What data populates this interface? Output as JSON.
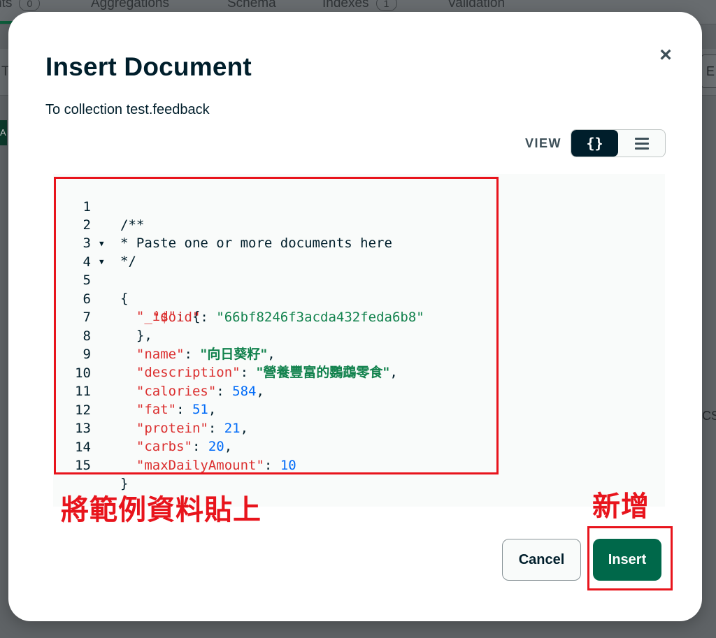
{
  "background": {
    "tabs": [
      {
        "label": "nts",
        "count": "0"
      },
      {
        "label": "Aggregations"
      },
      {
        "label": "Schema"
      },
      {
        "label": "Indexes",
        "count": "1"
      },
      {
        "label": "Validation"
      }
    ],
    "left_letter": "T",
    "left_badge": "A",
    "right_button": "E",
    "right_text": "CSV"
  },
  "modal": {
    "title": "Insert Document",
    "subtitle": "To collection test.feedback",
    "view_label": "VIEW",
    "view_options": [
      {
        "icon": "json-braces-icon",
        "glyph": "{}",
        "active": true
      },
      {
        "icon": "list-icon",
        "active": false
      }
    ],
    "close_icon": "close-icon",
    "cancel_label": "Cancel",
    "insert_label": "Insert"
  },
  "editor": {
    "lines": [
      {
        "n": "1"
      },
      {
        "n": "2"
      },
      {
        "n": "3"
      },
      {
        "n": "4"
      },
      {
        "n": "5"
      },
      {
        "n": "6"
      },
      {
        "n": "7"
      },
      {
        "n": "8"
      },
      {
        "n": "9"
      },
      {
        "n": "10"
      },
      {
        "n": "11"
      },
      {
        "n": "12"
      },
      {
        "n": "13"
      },
      {
        "n": "14"
      },
      {
        "n": "15"
      }
    ],
    "comment1": "/**",
    "comment2": "* Paste one or more documents here",
    "comment3": "*/",
    "open_brace": "{",
    "id_key": "\"_id\"",
    "oid_key": "\"$oid\"",
    "oid_value": "\"66bf8246f3acda432feda6b8\"",
    "close_id": "},",
    "name_key": "\"name\"",
    "name_value": "\"向日葵籽\"",
    "description_key": "\"description\"",
    "description_value": "\"營養豐富的鸚鵡零食\"",
    "calories_key": "\"calories\"",
    "calories_value": "584",
    "fat_key": "\"fat\"",
    "fat_value": "51",
    "protein_key": "\"protein\"",
    "protein_value": "21",
    "carbs_key": "\"carbs\"",
    "carbs_value": "20",
    "maxdaily_key": "\"maxDailyAmount\"",
    "maxdaily_value": "10",
    "close_brace": "}"
  },
  "annotations": {
    "paste_label": "將範例資料貼上",
    "insert_label": "新增"
  }
}
